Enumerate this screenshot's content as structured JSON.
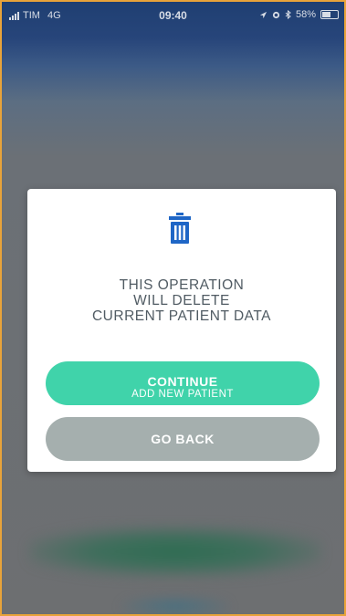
{
  "status_bar": {
    "carrier": "TIM",
    "network": "4G",
    "time": "09:40",
    "battery_text": "58%",
    "battery_level": 0.58
  },
  "dialog": {
    "icon": "trash-icon",
    "message_lines": [
      "THIS OPERATION",
      "WILL DELETE",
      "CURRENT PATIENT DATA"
    ],
    "continue_label": "CONTINUE",
    "continue_sublabel": "ADD NEW PATIENT",
    "back_label": "GO BACK"
  },
  "colors": {
    "accent_green": "#40d3aa",
    "secondary_gray": "#a5afae",
    "icon_blue": "#1f66c6",
    "frame_orange": "#e8a33a"
  }
}
